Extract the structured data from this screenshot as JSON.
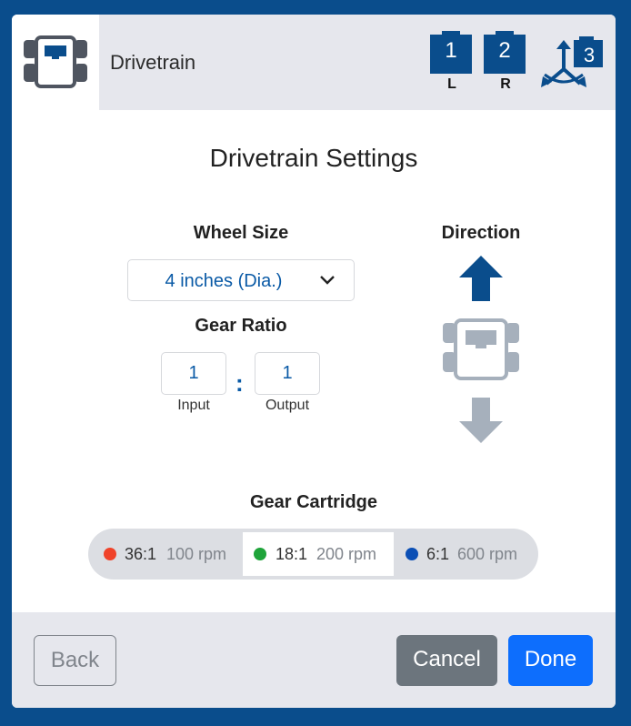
{
  "header": {
    "title": "Drivetrain",
    "ports": [
      {
        "number": "1",
        "label": "L"
      },
      {
        "number": "2",
        "label": "R"
      },
      {
        "number": "3",
        "label": ""
      }
    ]
  },
  "main": {
    "title": "Drivetrain Settings",
    "wheel_size": {
      "label": "Wheel Size",
      "value": "4 inches (Dia.)"
    },
    "gear_ratio": {
      "label": "Gear Ratio",
      "input_value": "1",
      "input_label": "Input",
      "separator": ":",
      "output_value": "1",
      "output_label": "Output"
    },
    "direction": {
      "label": "Direction",
      "selected": "forward"
    },
    "gear_cartridge": {
      "label": "Gear Cartridge",
      "selected_index": 1,
      "options": [
        {
          "ratio": "36:1",
          "rpm": "100 rpm",
          "color": "#f0432a"
        },
        {
          "ratio": "18:1",
          "rpm": "200 rpm",
          "color": "#1fa43a"
        },
        {
          "ratio": "6:1",
          "rpm": "600 rpm",
          "color": "#0b4fb5"
        }
      ]
    }
  },
  "footer": {
    "back_label": "Back",
    "cancel_label": "Cancel",
    "done_label": "Done"
  },
  "colors": {
    "frame": "#0a4d8c",
    "accent": "#0a5aa6",
    "primary_button": "#0d6efd",
    "secondary_button": "#6c757d",
    "inactive_arrow": "#a6b0bc"
  }
}
